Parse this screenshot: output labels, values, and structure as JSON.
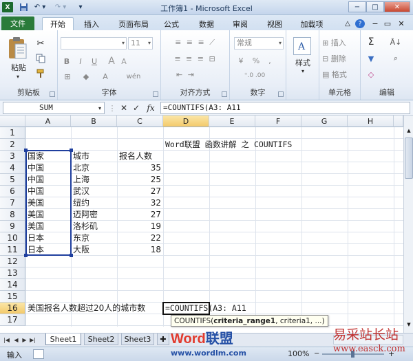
{
  "window": {
    "title": "工作簿1 - Microsoft Excel",
    "icon": "excel-icon",
    "controls": {
      "minimize": "−",
      "maximize": "□",
      "close": "✕"
    }
  },
  "quick_access": {
    "save": "save-icon",
    "undo": "undo-icon",
    "redo": "redo-icon",
    "customize": "▾"
  },
  "tabs": [
    {
      "label": "文件"
    },
    {
      "label": "开始"
    },
    {
      "label": "插入"
    },
    {
      "label": "页面布局"
    },
    {
      "label": "公式"
    },
    {
      "label": "数据"
    },
    {
      "label": "审阅"
    },
    {
      "label": "视图"
    },
    {
      "label": "加载项"
    }
  ],
  "ribbon": {
    "groups": {
      "clipboard": "剪贴板",
      "font": "字体",
      "alignment": "对齐方式",
      "number": "数字",
      "cells": "单元格",
      "editing": "编辑"
    },
    "paste_label": "粘贴",
    "font_size": "11",
    "number_format": "常规",
    "percent": "%",
    "style_label": "样式",
    "insert": "插入",
    "delete": "删除",
    "format": "格式",
    "bold": "B",
    "italic": "I",
    "underline": "U",
    "sigma": "Σ",
    "wen": "wén"
  },
  "formula_bar": {
    "name_box": "SUM",
    "formula": "=COUNTIFS(A3: A11",
    "fx": "fx",
    "cancel": "✕",
    "enter": "✓"
  },
  "columns": [
    "A",
    "B",
    "C",
    "D",
    "E",
    "F",
    "G",
    "H"
  ],
  "rows": [
    "1",
    "2",
    "3",
    "4",
    "5",
    "6",
    "7",
    "8",
    "9",
    "10",
    "11",
    "12",
    "13",
    "14",
    "15",
    "16",
    "17"
  ],
  "cells": {
    "d2": "Word联盟 函数讲解 之  COUNTIFS",
    "a3": "国家",
    "b3": "城市",
    "c3": "报名人数",
    "table": [
      {
        "country": "中国",
        "city": "北京",
        "count": "35"
      },
      {
        "country": "中国",
        "city": "上海",
        "count": "25"
      },
      {
        "country": "中国",
        "city": "武汉",
        "count": "27"
      },
      {
        "country": "美国",
        "city": "纽约",
        "count": "32"
      },
      {
        "country": "美国",
        "city": "迈阿密",
        "count": "27"
      },
      {
        "country": "美国",
        "city": "洛杉矶",
        "count": "19"
      },
      {
        "country": "日本",
        "city": "东京",
        "count": "22"
      },
      {
        "country": "日本",
        "city": "大阪",
        "count": "18"
      }
    ],
    "a16": "美国报名人数超过20人的城市数",
    "d16_fn": "=COUNTIFS",
    "d16_rest": "(A3: A11"
  },
  "tooltip": {
    "fn": "COUNTIFS(",
    "arg1": "criteria_range1",
    "rest": ", criteria1, ...)"
  },
  "sheets": [
    "Sheet1",
    "Sheet2",
    "Sheet3"
  ],
  "status": {
    "mode": "输入",
    "zoom": "100%"
  },
  "watermark": {
    "brand_word": "Word",
    "brand_cn": "联盟",
    "url": "www.wordlm.com",
    "site": "易采站长站",
    "site_url": "www.easck.com"
  }
}
